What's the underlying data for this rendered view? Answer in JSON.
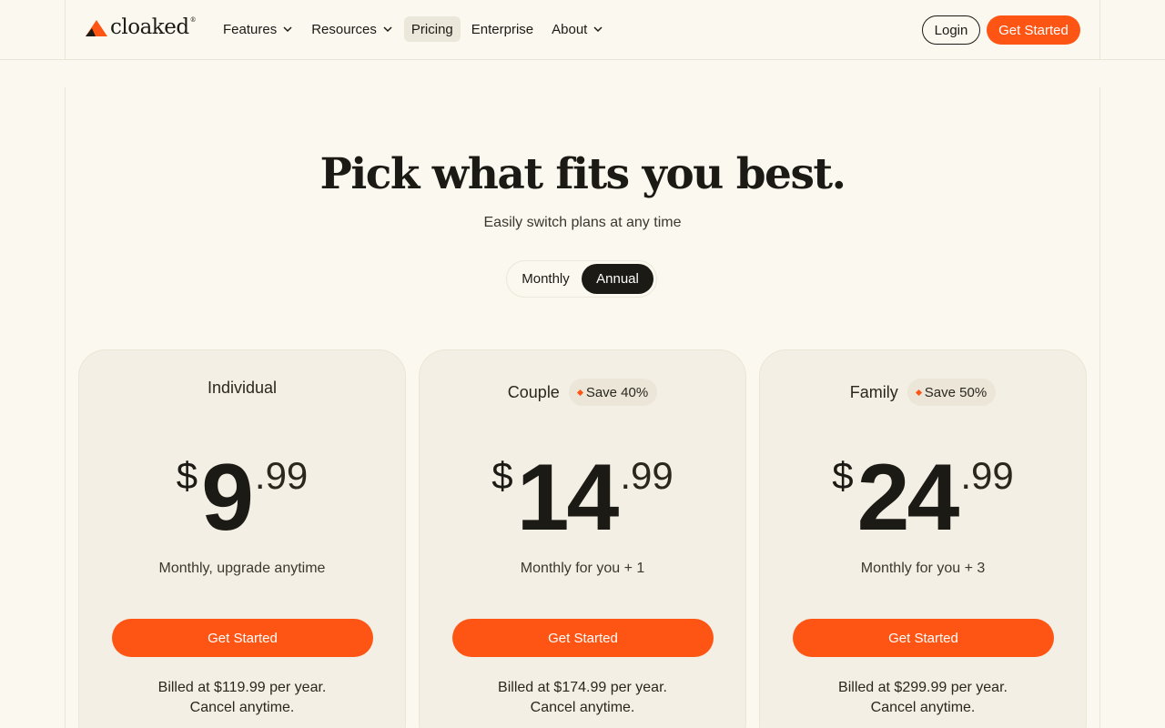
{
  "brand": {
    "name": "cloaked",
    "reg": "®",
    "accent": "#ff5514"
  },
  "nav": {
    "items": [
      {
        "label": "Features",
        "dropdown": true
      },
      {
        "label": "Resources",
        "dropdown": true
      },
      {
        "label": "Pricing",
        "dropdown": false,
        "active": true
      },
      {
        "label": "Enterprise",
        "dropdown": false
      },
      {
        "label": "About",
        "dropdown": true
      }
    ],
    "login_label": "Login",
    "cta_label": "Get Started"
  },
  "hero": {
    "title": "Pick what fits you best.",
    "subtitle": "Easily switch plans at any time",
    "toggle": {
      "monthly": "Monthly",
      "annual": "Annual",
      "selected": "Annual"
    }
  },
  "plans": [
    {
      "name": "Individual",
      "badge": "",
      "currency": "$",
      "amount": "9",
      "cents": ".99",
      "note": "Monthly, upgrade anytime",
      "cta": "Get Started",
      "billing": "Billed at $119.99 per year.",
      "cancel": "Cancel anytime."
    },
    {
      "name": "Couple",
      "badge": "Save 40%",
      "currency": "$",
      "amount": "14",
      "cents": ".99",
      "note": "Monthly for you + 1",
      "cta": "Get Started",
      "billing": "Billed at $174.99 per year.",
      "cancel": "Cancel anytime."
    },
    {
      "name": "Family",
      "badge": "Save 50%",
      "currency": "$",
      "amount": "24",
      "cents": ".99",
      "note": "Monthly for you + 3",
      "cta": "Get Started",
      "billing": "Billed at $299.99 per year.",
      "cancel": "Cancel anytime."
    }
  ]
}
